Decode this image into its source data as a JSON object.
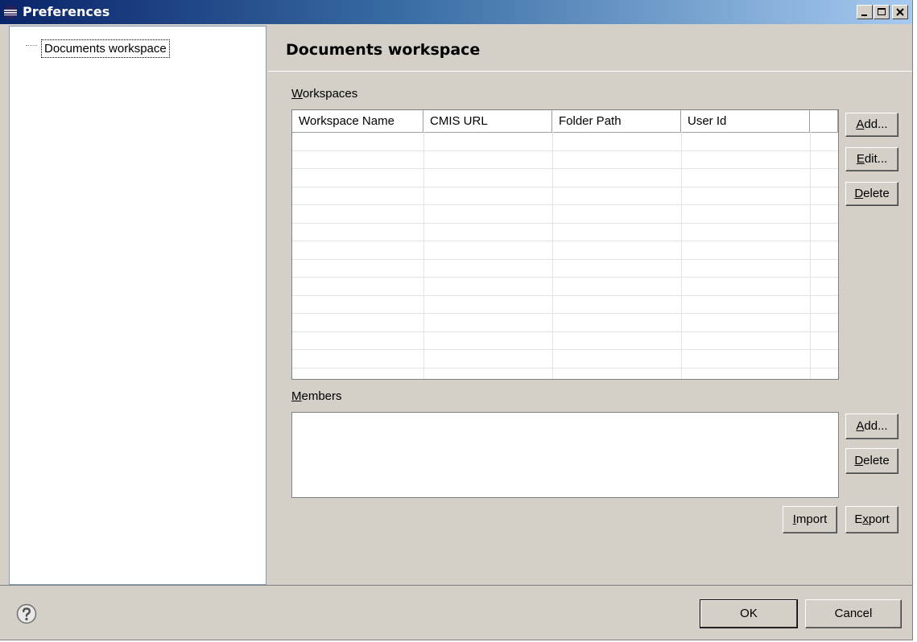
{
  "window": {
    "title": "Preferences",
    "controls": [
      "minimize",
      "maximize",
      "close"
    ]
  },
  "tree": {
    "items": [
      {
        "label": "Documents workspace",
        "selected": true
      }
    ]
  },
  "page": {
    "title": "Documents workspace"
  },
  "workspaces": {
    "label_mnemonic": "W",
    "label_rest": "orkspaces",
    "columns": [
      "Workspace Name",
      "CMIS URL",
      "Folder Path",
      "User Id",
      ""
    ],
    "rows": [],
    "buttons": {
      "add": {
        "mn": "A",
        "rest": "dd..."
      },
      "edit": {
        "mn": "E",
        "rest": "dit..."
      },
      "delete": {
        "mn": "D",
        "rest": "elete"
      }
    }
  },
  "members": {
    "label_mnemonic": "M",
    "label_rest": "embers",
    "items": [],
    "buttons": {
      "add": {
        "mn": "A",
        "rest": "dd..."
      },
      "delete": {
        "mn": "D",
        "rest": "elete"
      }
    }
  },
  "import_export": {
    "import": {
      "mn": "I",
      "rest": "mport"
    },
    "export_pre": "E",
    "export_mn": "x",
    "export_rest": "port"
  },
  "dialog_buttons": {
    "ok": "OK",
    "cancel": "Cancel"
  },
  "icons": {
    "app": "eclipse-icon",
    "help": "help-icon"
  },
  "colors": {
    "title_start": "#0a246a",
    "title_end": "#a6caf0",
    "background": "#d4d0c8"
  }
}
